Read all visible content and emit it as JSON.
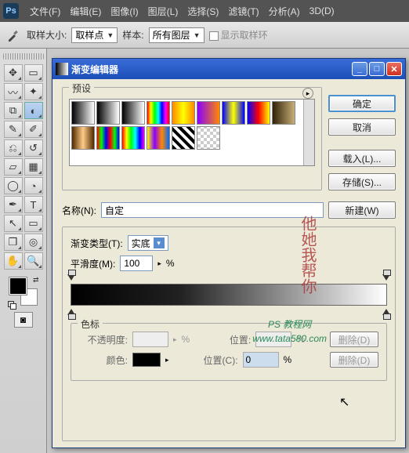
{
  "menubar": [
    "文件(F)",
    "编辑(E)",
    "图像(I)",
    "图层(L)",
    "选择(S)",
    "滤镜(T)",
    "分析(A)",
    "3D(D)"
  ],
  "options": {
    "sample_size_label": "取样大小:",
    "sample_size_value": "取样点",
    "sample_label": "样本:",
    "sample_value": "所有图层",
    "show_ring": "显示取样环"
  },
  "dialog": {
    "title": "渐变编辑器",
    "preset_label": "预设",
    "buttons": {
      "ok": "确定",
      "cancel": "取消",
      "load": "载入(L)...",
      "save": "存储(S)..."
    },
    "name_label": "名称(N):",
    "name_value": "自定",
    "new_btn": "新建(W)",
    "type_label": "渐变类型(T):",
    "type_value": "实底",
    "smooth_label": "平滑度(M):",
    "smooth_value": "100",
    "percent": "%",
    "stops_label": "色标",
    "opacity_label": "不透明度:",
    "position_label": "位置:",
    "position_c_label": "位置(C):",
    "position_c_value": "0",
    "color_label": "颜色:",
    "delete_btn": "删除(D)"
  },
  "watermark": {
    "vert": "他她我帮你",
    "line1": "PS 教程网",
    "line2": "www.tata580.com"
  },
  "chart_data": {
    "type": "gradient",
    "stops": [
      {
        "pos": 0,
        "color": "#000000"
      },
      {
        "pos": 100,
        "color": "#ffffff"
      }
    ],
    "opacity_stops": [
      {
        "pos": 0,
        "opacity": 100
      },
      {
        "pos": 100,
        "opacity": 100
      }
    ]
  }
}
